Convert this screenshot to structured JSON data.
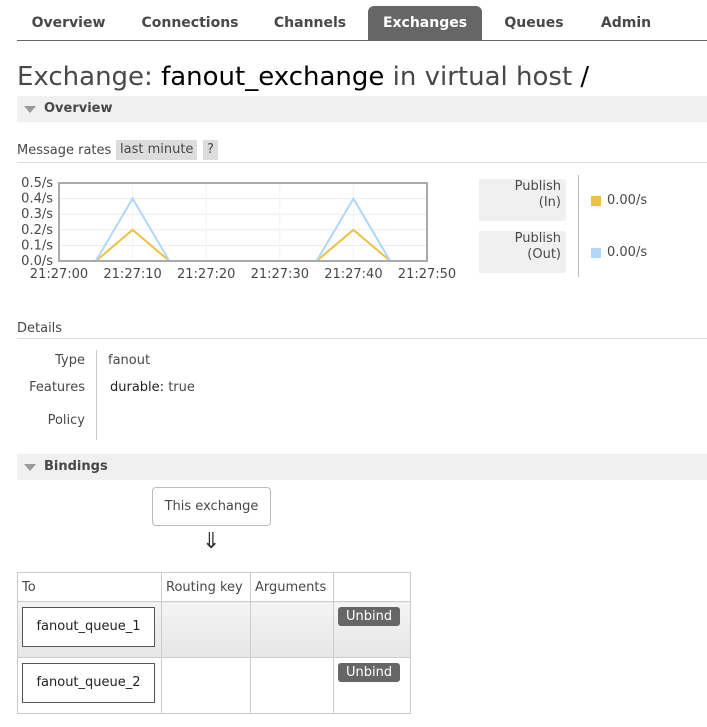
{
  "nav": {
    "tabs": [
      "Overview",
      "Connections",
      "Channels",
      "Exchanges",
      "Queues",
      "Admin"
    ],
    "active": "Exchanges"
  },
  "title": {
    "prefix": "Exchange:",
    "name": "fanout_exchange",
    "vhost_text": "in virtual host",
    "vhost": "/"
  },
  "overview": {
    "header": "Overview",
    "message_rates_label": "Message rates",
    "range_label": "last minute",
    "help_label": "?"
  },
  "chart_data": {
    "type": "line",
    "x": [
      "21:27:00",
      "21:27:05",
      "21:27:10",
      "21:27:15",
      "21:27:20",
      "21:27:25",
      "21:27:30",
      "21:27:35",
      "21:27:40",
      "21:27:45",
      "21:27:50"
    ],
    "tick_labels": [
      "21:27:00",
      "21:27:10",
      "21:27:20",
      "21:27:30",
      "21:27:40",
      "21:27:50"
    ],
    "y_tick_labels": [
      "0.5/s",
      "0.4/s",
      "0.3/s",
      "0.2/s",
      "0.1/s",
      "0.0/s"
    ],
    "ylim": [
      0,
      0.5
    ],
    "series": [
      {
        "name": "Publish (In)",
        "color": "#edc240",
        "values": [
          0,
          0,
          0.2,
          0,
          0,
          0,
          0,
          0,
          0.2,
          0,
          0
        ]
      },
      {
        "name": "Publish (Out)",
        "color": "#afd8f8",
        "values": [
          0,
          0,
          0.4,
          0,
          0,
          0,
          0,
          0,
          0.4,
          0,
          0
        ]
      }
    ],
    "grid": true
  },
  "legend": [
    {
      "label_line1": "Publish",
      "label_line2": "(In)",
      "value": "0.00/s",
      "color": "#edc240"
    },
    {
      "label_line1": "Publish",
      "label_line2": "(Out)",
      "value": "0.00/s",
      "color": "#afd8f8"
    }
  ],
  "details": {
    "header": "Details",
    "type_label": "Type",
    "type_value": "fanout",
    "features_label": "Features",
    "features_key": "durable:",
    "features_value": "true",
    "policy_label": "Policy"
  },
  "bindings": {
    "header": "Bindings",
    "this_exchange": "This exchange",
    "arrow": "⇓",
    "columns": [
      "To",
      "Routing key",
      "Arguments"
    ],
    "rows": [
      {
        "to": "fanout_queue_1",
        "action": "Unbind"
      },
      {
        "to": "fanout_queue_2",
        "action": "Unbind"
      }
    ]
  }
}
